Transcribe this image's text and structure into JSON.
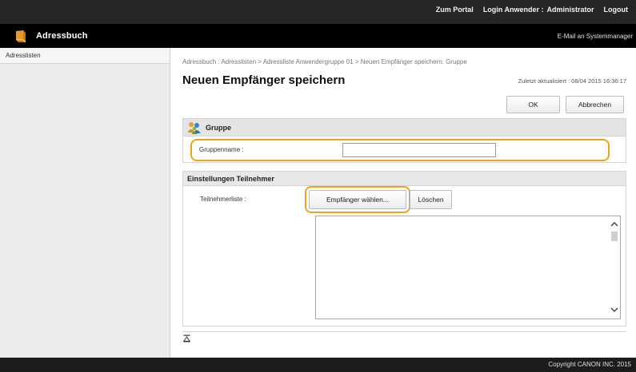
{
  "header": {
    "links": [
      "Zum Portal",
      "Login Anwender :",
      "Administrator",
      "Logout"
    ]
  },
  "app": {
    "title": "Adressbuch",
    "mail_link": "E-Mail an Systemmanager",
    "icon": "book-icon"
  },
  "sidebar": {
    "items": [
      {
        "label": "Adresslisten"
      }
    ]
  },
  "breadcrumb": "Adressbuch : Adresslisten > Adressliste Anwendergruppe 01 > Neuen Empfänger speichern: Gruppe",
  "page_title": "Neuen Empfänger speichern",
  "updated": "Zuletzt aktualisiert : 08/04 2015 16:36:17",
  "buttons": {
    "ok": "OK",
    "cancel": "Abbrechen"
  },
  "group_panel": {
    "title": "Gruppe",
    "icon": "group-icon",
    "group_name_label": "Gruppenname :",
    "group_name_value": ""
  },
  "participants": {
    "title": "Einstellungen Teilnehmer",
    "list_label": "Teilnehmerliste :",
    "select_button": "Empfänger wählen...",
    "delete_button": "Löschen",
    "items": []
  },
  "back_to_top_icon": "to-top-icon",
  "footer": {
    "copyright": "Copyright CANON INC. 2015"
  },
  "colors": {
    "highlight": "#f0a21b",
    "topbar": "#262626",
    "appbar": "#000000",
    "footer": "#1c1c1c"
  }
}
